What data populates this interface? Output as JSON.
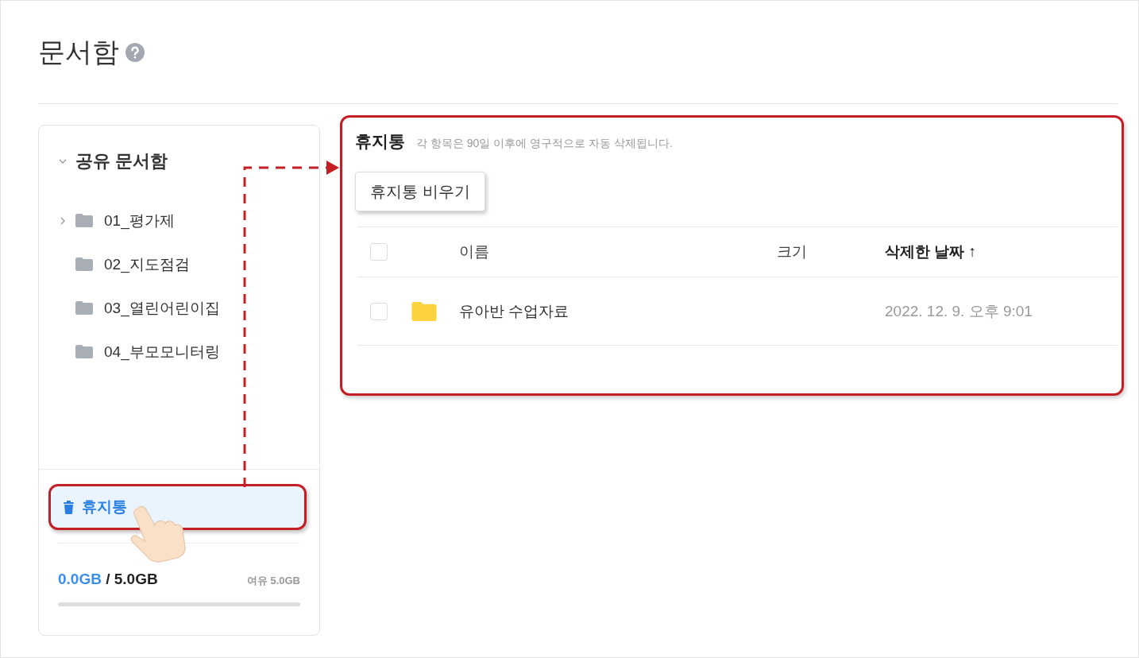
{
  "page": {
    "title": "문서함"
  },
  "sidebar": {
    "root": {
      "label": "공유 문서함",
      "expanded": true,
      "children": [
        {
          "label": "01_평가제",
          "expandable": true
        },
        {
          "label": "02_지도점검",
          "expandable": false
        },
        {
          "label": "03_열린어린이집",
          "expandable": false
        },
        {
          "label": "04_부모모니터링",
          "expandable": false
        }
      ]
    },
    "trash_item": {
      "label": "휴지통",
      "selected": true
    },
    "storage": {
      "used": "0.0GB",
      "separator": " / ",
      "total": "5.0GB",
      "free": "여유 5.0GB",
      "level": 0
    }
  },
  "trash_panel": {
    "title": "휴지통",
    "note": "각 항목은 90일 이후에 영구적으로 자동 삭제됩니다.",
    "empty_button": "휴지통 비우기",
    "table": {
      "select_all_checked": false,
      "columns": [
        {
          "label": "이름",
          "sorted": false
        },
        {
          "label": "크기",
          "sorted": false
        },
        {
          "label": "삭제한 날짜",
          "sorted": true,
          "sort_arrow": "↑"
        }
      ],
      "rows": [
        {
          "kind": "folder",
          "checked": false,
          "name": "유아반 수업자료",
          "size": "",
          "deleted": "2022. 12. 9. 오후 9:01"
        }
      ]
    }
  }
}
